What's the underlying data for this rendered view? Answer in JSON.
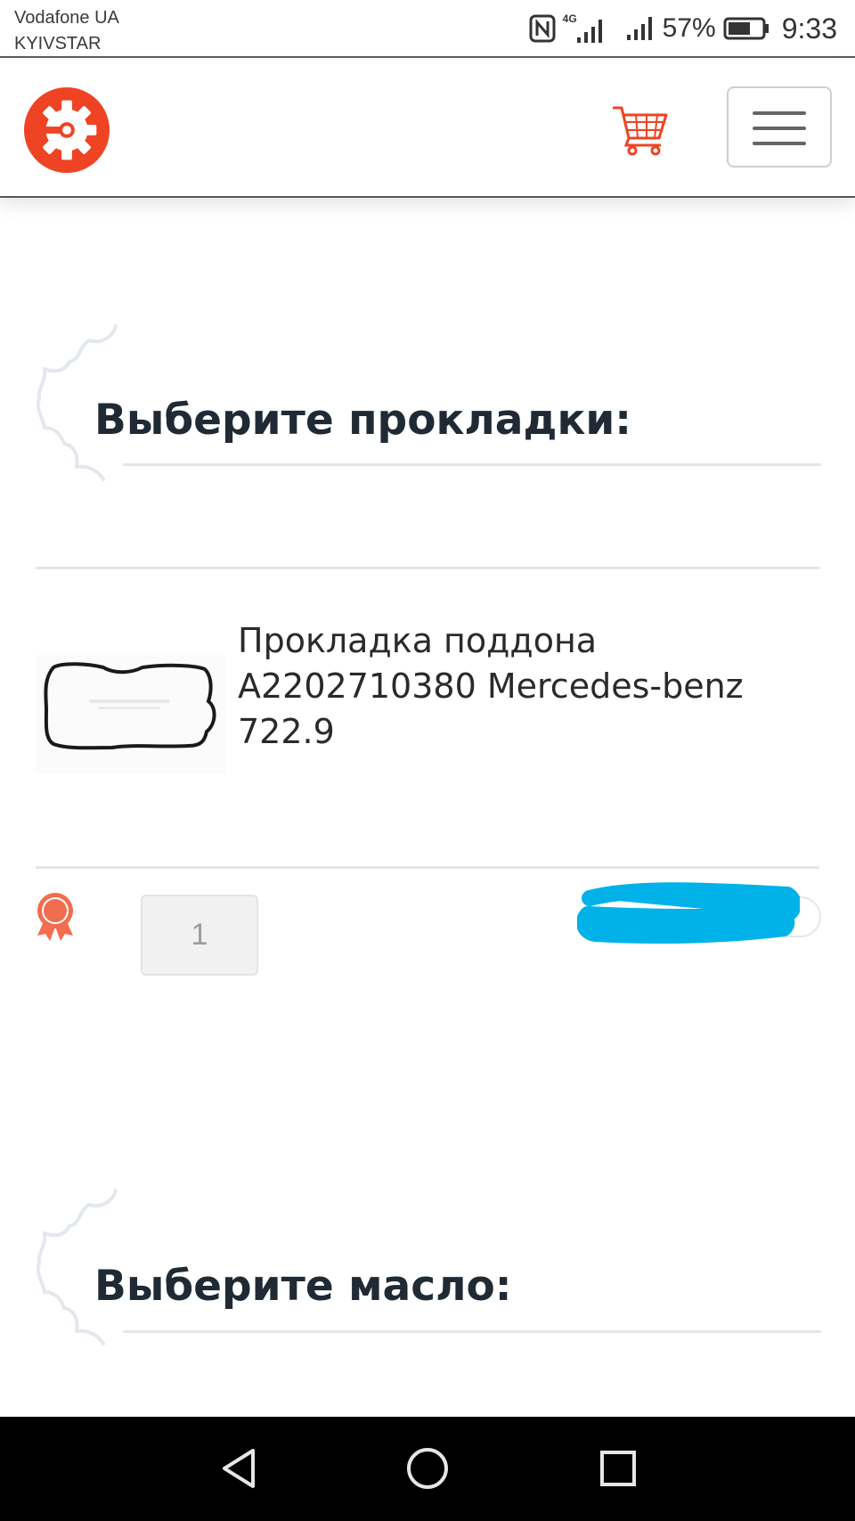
{
  "status_bar": {
    "carrier_1": "Vodafone UA",
    "carrier_2": "KYIVSTAR",
    "network": "4G",
    "battery": "57%",
    "time": "9:33"
  },
  "header": {
    "logo_icon": "gear-logo-icon",
    "cart_icon": "cart-icon",
    "menu_icon": "hamburger-menu-icon",
    "brand_color": "#ee4423"
  },
  "sections": {
    "gaskets_title": "Выберите прокладки:",
    "oil_title": "Выберите масло:"
  },
  "product": {
    "name": "Прокладка поддона A2202710380 Mercedes-benz 722.9",
    "quantity": "1",
    "award_icon": "award-badge-icon"
  },
  "nav_bar": {
    "back_icon": "back-triangle-icon",
    "home_icon": "home-circle-icon",
    "recents_icon": "recents-square-icon"
  }
}
